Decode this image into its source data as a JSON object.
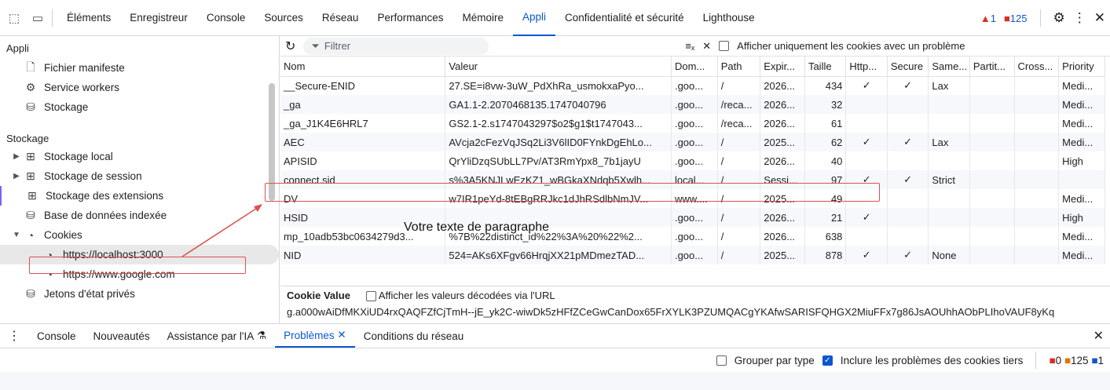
{
  "topbar": {
    "tabs": [
      "Éléments",
      "Enregistreur",
      "Console",
      "Sources",
      "Réseau",
      "Performances",
      "Mémoire",
      "Appli",
      "Confidentialité et sécurité",
      "Lighthouse"
    ],
    "active_tab": "Appli",
    "warnings": "1",
    "errors": "125"
  },
  "sidebar": {
    "appli_header": "Appli",
    "appli_items": [
      "Fichier manifeste",
      "Service workers",
      "Stockage"
    ],
    "storage_header": "Stockage",
    "storage_items": [
      "Stockage local",
      "Stockage de session",
      "Stockage des extensions",
      "Base de données indexée",
      "Cookies"
    ],
    "cookie_sites": [
      "https://localhost:3000",
      "https://www.google.com"
    ],
    "private_tokens": "Jetons d'état privés"
  },
  "toolbar": {
    "filter_placeholder": "Filtrer",
    "only_problem_label": "Afficher uniquement les cookies avec un problème"
  },
  "table": {
    "headers": [
      "Nom",
      "Valeur",
      "Dom...",
      "Path",
      "Expir...",
      "Taille",
      "Http...",
      "Secure",
      "Same...",
      "Partit...",
      "Cross...",
      "Priority"
    ],
    "rows": [
      [
        "__Secure-ENID",
        "27.SE=i8vw-3uW_PdXhRa_usmokxaPyo...",
        ".goo...",
        "/",
        "2026...",
        "434",
        "✓",
        "✓",
        "Lax",
        "",
        "",
        "Medi..."
      ],
      [
        "_ga",
        "GA1.1-2.2070468135.1747040796",
        ".goo...",
        "/reca...",
        "2026...",
        "32",
        "",
        "",
        "",
        "",
        "",
        "Medi..."
      ],
      [
        "_ga_J1K4E6HRL7",
        "GS2.1-2.s1747043297$o2$g1$t1747043...",
        ".goo...",
        "/reca...",
        "2026...",
        "61",
        "",
        "",
        "",
        "",
        "",
        "Medi..."
      ],
      [
        "AEC",
        "AVcja2cFezVqJSq2Li3V6lID0FYnkDgEhLo...",
        ".goo...",
        "/",
        "2025...",
        "62",
        "✓",
        "✓",
        "Lax",
        "",
        "",
        "Medi..."
      ],
      [
        "APISID",
        "QrYliDzqSUbLL7Pv/AT3RmYpx8_7b1jayU",
        ".goo...",
        "/",
        "2026...",
        "40",
        "",
        "",
        "",
        "",
        "",
        "High"
      ],
      [
        "connect.sid",
        "s%3A5KNJLwEzKZ1_wBGkaXNdqb5Xwlh...",
        "local...",
        "/",
        "Sessi...",
        "97",
        "✓",
        "✓",
        "Strict",
        "",
        "",
        ""
      ],
      [
        "DV",
        "w7IR1peYd-8tEBgRRJkc1dJhRSdlbNmJV...",
        "www....",
        "/",
        "2025...",
        "49",
        "",
        "",
        "",
        "",
        "",
        "Medi..."
      ],
      [
        "HSID",
        "",
        ".goo...",
        "/",
        "2026...",
        "21",
        "✓",
        "",
        "",
        "",
        "",
        "High"
      ],
      [
        "mp_10adb53bc0634279d3...",
        "%7B%22distinct_id%22%3A%20%22%2...",
        ".goo...",
        "/",
        "2026...",
        "638",
        "",
        "",
        "",
        "",
        "",
        "Medi..."
      ],
      [
        "NID",
        "524=AKs6XFgv66HrqjXX21pMDmezTAD...",
        ".goo...",
        "/",
        "2025...",
        "878",
        "✓",
        "✓",
        "None",
        "",
        "",
        "Medi..."
      ]
    ]
  },
  "cookie_value": {
    "label": "Cookie Value",
    "decode_label": "Afficher les valeurs décodées via l'URL",
    "value": "g.a000wAiDfMKXiUD4rxQAQFZfCjTmH--jE_yk2C-wiwDk5zHFfZCeGwCanDox65FrXYLK3PZUMQACgYKAfwSARISFQHGX2MiuFFx7g86JsAOUhhAObPLIhoVAUF8yKq"
  },
  "overlay_text": "Votre texte de paragraphe",
  "drawer": {
    "tabs": [
      "Console",
      "Nouveautés",
      "Assistance par l'IA",
      "Problèmes",
      "Conditions du réseau"
    ],
    "active_tab": "Problèmes",
    "group_label": "Grouper par type",
    "third_party_label": "Inclure les problèmes des cookies tiers",
    "errors": "0",
    "warnings": "125",
    "infos": "1"
  },
  "colors": {
    "accent": "#0b57d0",
    "annotation": "#d9534f"
  }
}
